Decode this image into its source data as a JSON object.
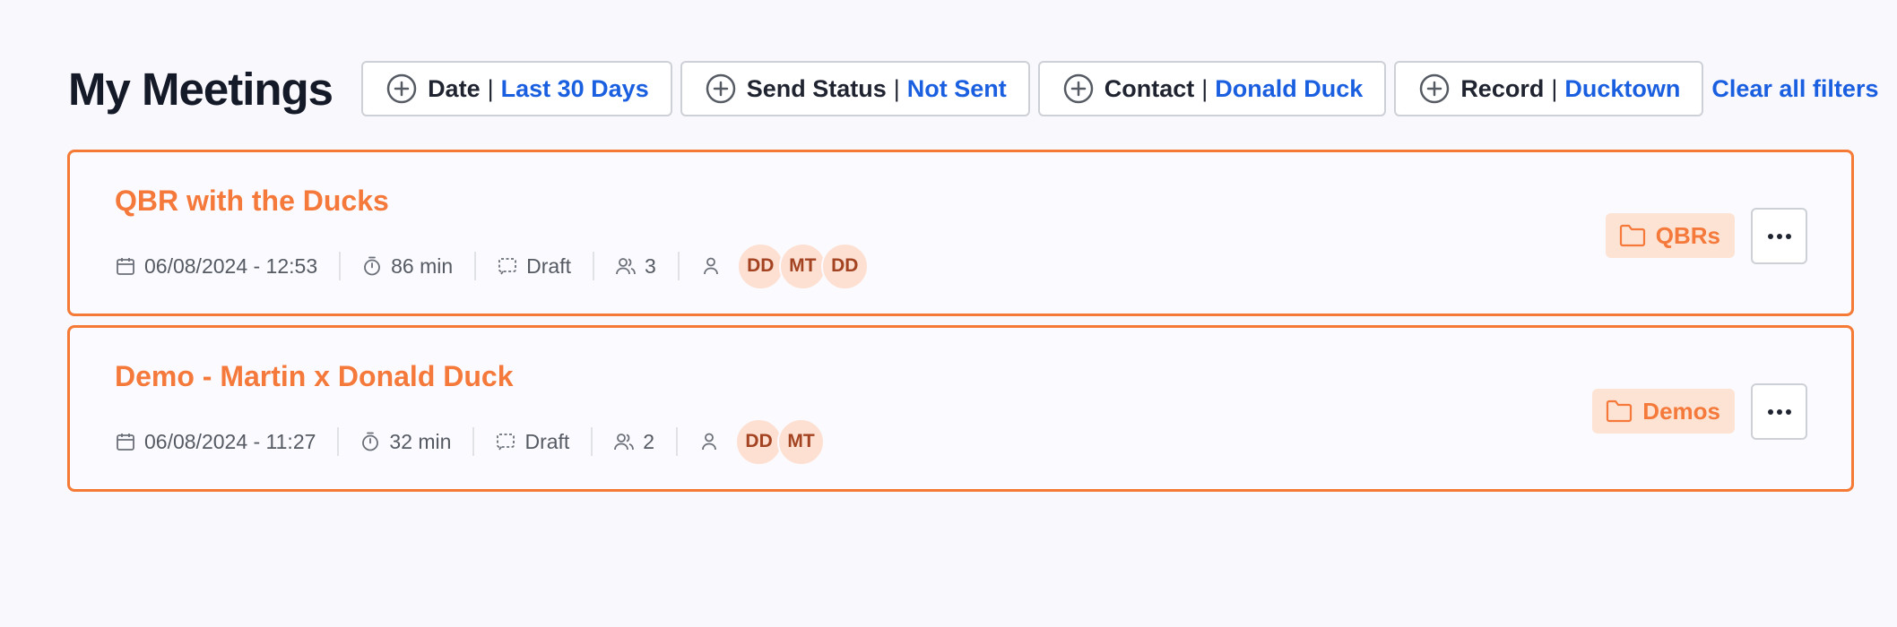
{
  "page": {
    "title": "My Meetings"
  },
  "filters": [
    {
      "name": "Date",
      "value": "Last 30 Days"
    },
    {
      "name": "Send Status",
      "value": "Not Sent"
    },
    {
      "name": "Contact",
      "value": "Donald Duck"
    },
    {
      "name": "Record",
      "value": "Ducktown"
    }
  ],
  "filter_separator": "|",
  "clear_filters_label": "Clear all filters",
  "meetings": [
    {
      "title": "QBR with the Ducks",
      "datetime": "06/08/2024 - 12:53",
      "duration": "86 min",
      "status": "Draft",
      "participants": "3",
      "attendees": [
        "DD",
        "MT",
        "DD"
      ],
      "folder": "QBRs"
    },
    {
      "title": "Demo - Martin x Donald Duck",
      "datetime": "06/08/2024 - 11:27",
      "duration": "32 min",
      "status": "Draft",
      "participants": "2",
      "attendees": [
        "DD",
        "MT"
      ],
      "folder": "Demos"
    }
  ],
  "colors": {
    "accent": "#f4793a",
    "link": "#1a5fe0",
    "avatar_bg": "#fde0d2",
    "tag_bg": "#fde3d4"
  },
  "icons": {
    "filter_add": "plus-circle-icon",
    "date": "calendar-icon",
    "duration": "stopwatch-icon",
    "status": "draft-icon",
    "participants": "users-icon",
    "attendees": "user-icon",
    "folder": "folder-icon",
    "more": "more-horizontal-icon"
  }
}
